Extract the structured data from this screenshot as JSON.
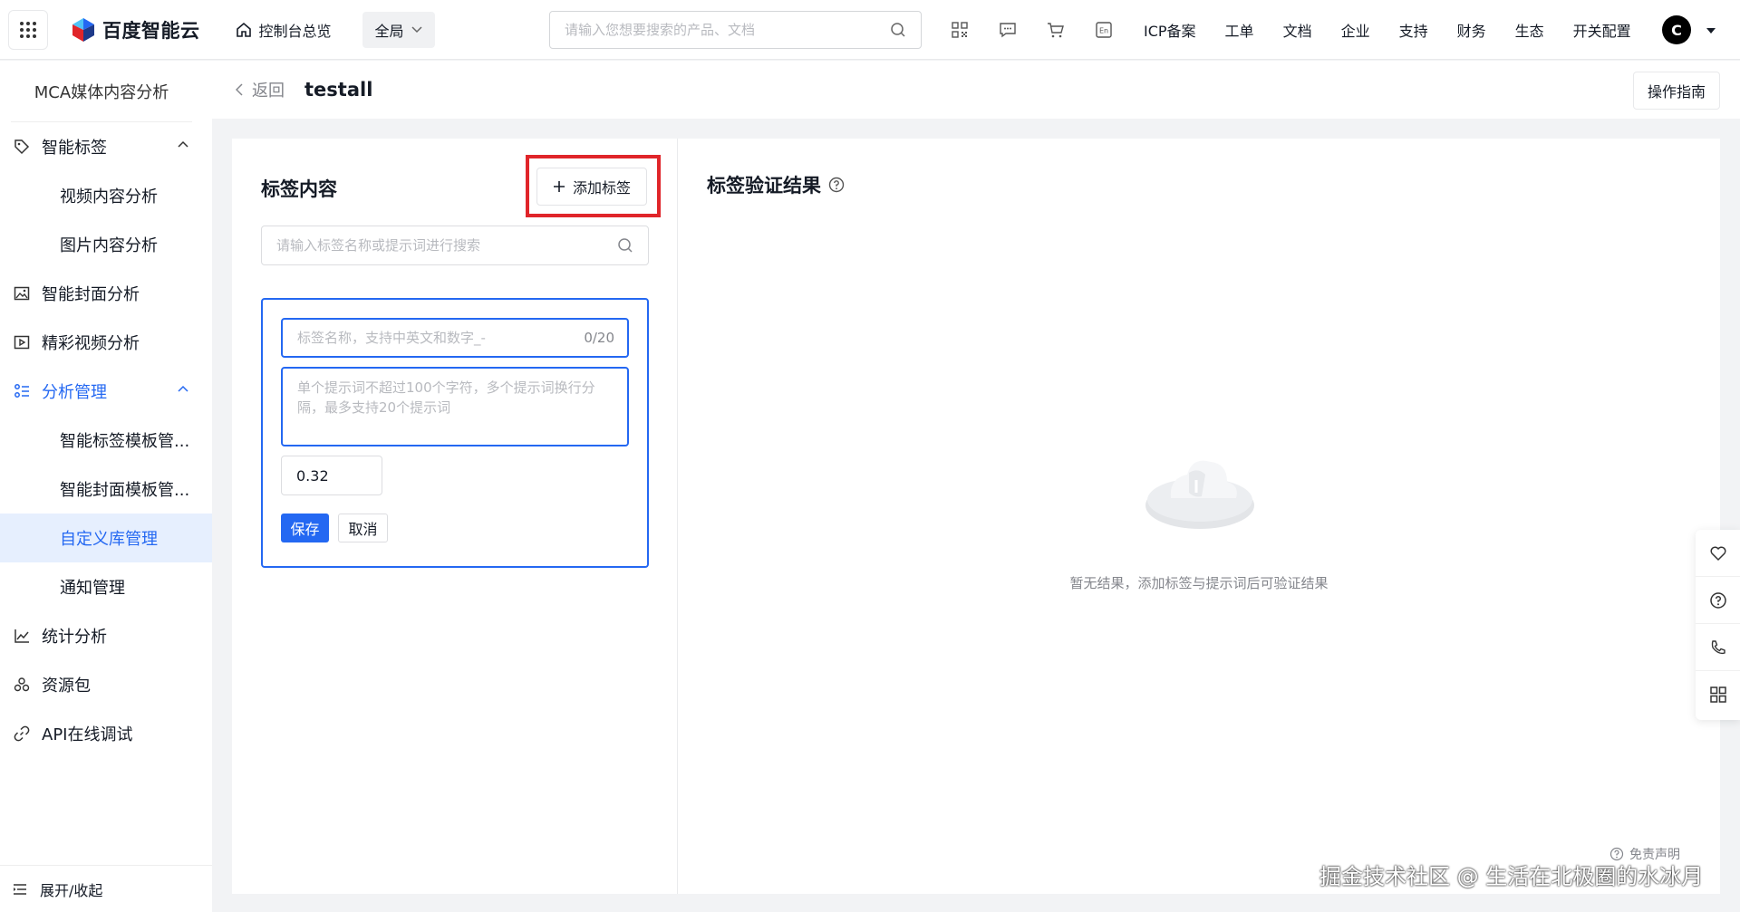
{
  "topbar": {
    "logo_text": "百度智能云",
    "console_label": "控制台总览",
    "region_label": "全局",
    "search_placeholder": "请输入您想要搜索的产品、文档",
    "nav": [
      "ICP备案",
      "工单",
      "文档",
      "企业",
      "支持",
      "财务",
      "生态",
      "开关配置"
    ],
    "avatar_letter": "C",
    "icons": [
      "qrcode-icon",
      "message-icon",
      "cart-icon",
      "language-icon"
    ]
  },
  "sidebar": {
    "title": "MCA媒体内容分析",
    "groups": [
      {
        "label": "智能标签",
        "icon": "tag-icon",
        "expanded": true,
        "children": [
          "视频内容分析",
          "图片内容分析"
        ]
      },
      {
        "label": "智能封面分析",
        "icon": "image-icon"
      },
      {
        "label": "精彩视频分析",
        "icon": "video-icon"
      },
      {
        "label": "分析管理",
        "icon": "manage-icon",
        "expanded": true,
        "active": true,
        "children": [
          "智能标签模板管...",
          "智能封面模板管...",
          "自定义库管理",
          "通知管理"
        ]
      },
      {
        "label": "统计分析",
        "icon": "chart-icon"
      },
      {
        "label": "资源包",
        "icon": "package-icon"
      },
      {
        "label": "API在线调试",
        "icon": "link-icon"
      }
    ],
    "active_item": "自定义库管理",
    "collapse_label": "展开/收起"
  },
  "header": {
    "back_label": "返回",
    "title": "testall",
    "guide_button": "操作指南"
  },
  "tag_pane": {
    "title": "标签内容",
    "add_button": "添加标签",
    "search_placeholder": "请输入标签名称或提示词进行搜索",
    "form": {
      "name_placeholder": "标签名称，支持中英文和数字_-",
      "name_counter": "0/20",
      "prompt_placeholder": "单个提示词不超过100个字符，多个提示词换行分隔，最多支持20个提示词",
      "threshold_value": "0.32",
      "save_label": "保存",
      "cancel_label": "取消"
    }
  },
  "result_pane": {
    "title": "标签验证结果",
    "empty_text": "暂无结果，添加标签与提示词后可验证结果",
    "disclaimer": "免责声明"
  },
  "float_toolbar": [
    "favorite-icon",
    "help-icon",
    "phone-icon",
    "apps-icon"
  ],
  "watermark": "掘金技术社区 @ 生活在北极圈的水冰月",
  "colors": {
    "accent": "#2468f2",
    "highlight_border": "#e0252a",
    "active_bg": "#e6effe",
    "page_bg": "#f2f3f5"
  }
}
